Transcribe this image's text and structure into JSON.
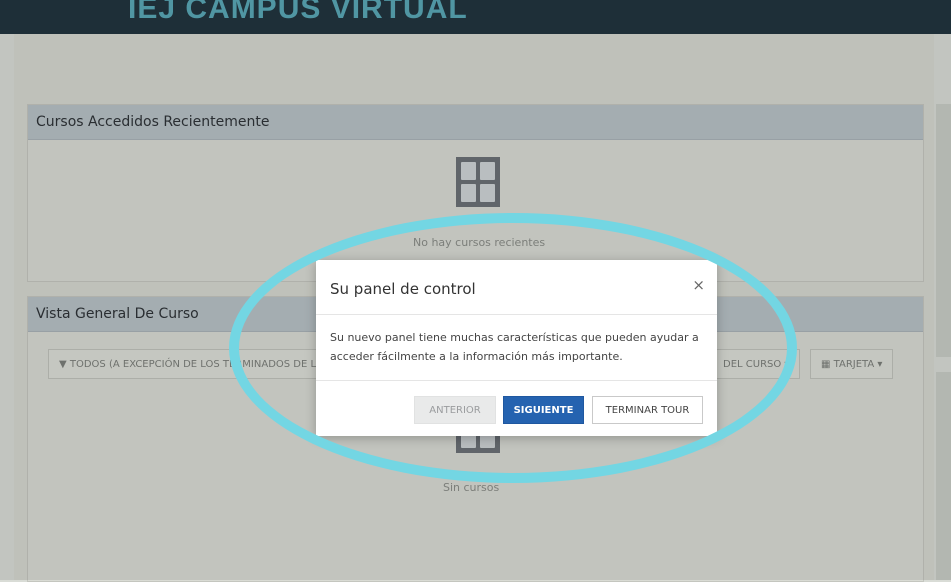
{
  "header": {
    "brand": "IEJ CAMPUS VIRTUAL"
  },
  "recent": {
    "title": "Cursos Accedidos Recientemente",
    "empty_text": "No hay cursos recientes"
  },
  "overview": {
    "title": "Vista General De Curso",
    "filter_label": "TODOS (A EXCEPCIÓN DE LOS TERMINADOS DE L",
    "sort_label": "DEL CURSO",
    "view_label": "TARJETA",
    "empty_text": "Sin cursos"
  },
  "modal": {
    "title": "Su panel de control",
    "close": "×",
    "body": "Su nuevo panel tiene muchas características que pueden ayudar a acceder fácilmente a la información más importante.",
    "prev_label": "ANTERIOR",
    "next_label": "SIGUIENTE",
    "end_label": "TERMINAR TOUR"
  },
  "colors": {
    "highlight_ring": "#73d6e3",
    "primary": "#2563b0"
  }
}
